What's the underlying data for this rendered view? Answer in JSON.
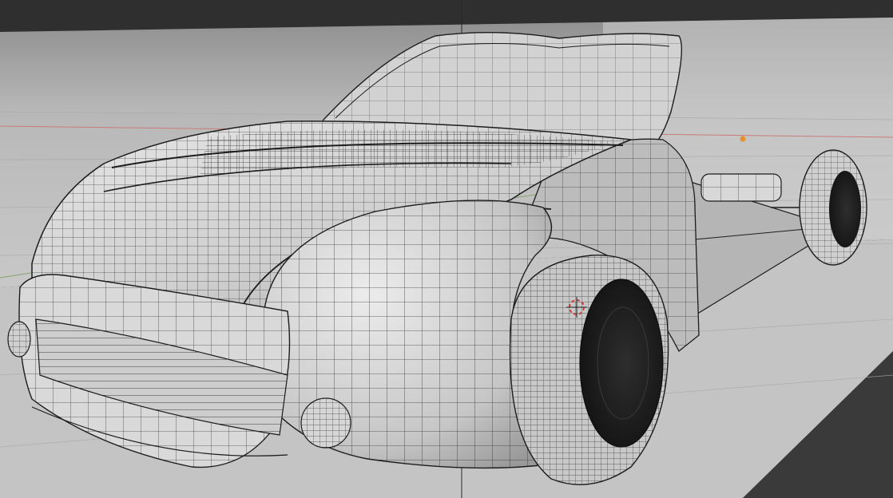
{
  "app": {
    "view": "3D Viewport",
    "shading_mode": "solid-wireframe",
    "overlays": [
      "3d-cursor",
      "light-object",
      "floor-grid",
      "axis-lines"
    ]
  },
  "colors": {
    "background_outer": "#3a3a3a",
    "backdrop_wall": "#bdbdbd",
    "floor_plane": "#c9c9c9",
    "mesh_fill": "#d4d4d4",
    "wire": "#1c1c1c",
    "tire": "#202020",
    "axis_red": "#c87b7b",
    "axis_green": "#8aa36f",
    "light_dot": "#e8902a",
    "cursor": "#d23b3b"
  },
  "icons": {
    "cursor": "3d-cursor-icon",
    "light": "light-object-icon"
  }
}
